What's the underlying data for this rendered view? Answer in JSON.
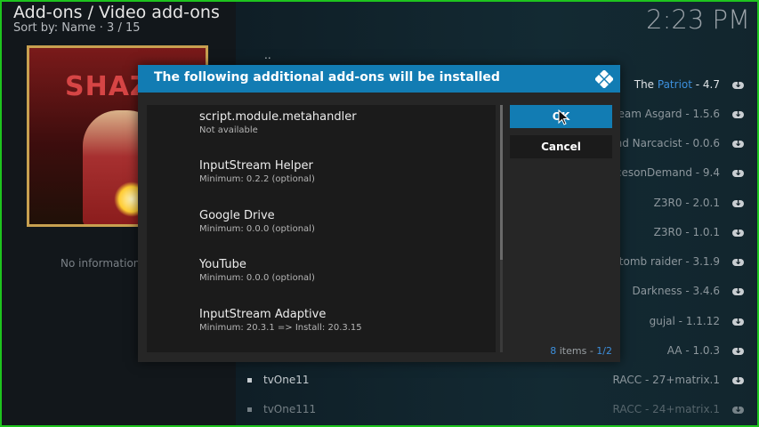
{
  "header": {
    "title": "Add-ons / Video add-ons",
    "sort": "Sort by: Name  ·  3 / 15",
    "clock": "2:23 PM"
  },
  "poster": {
    "text": "SHAZAM"
  },
  "left": {
    "no_info": "No information a"
  },
  "list": {
    "parent": "..",
    "right_items": [
      {
        "prefix": "The ",
        "highlight": "Patriot",
        "suffix": " - 4.7"
      },
      {
        "prefix": "Team Asgard - 1.5.6"
      },
      {
        "prefix": "ot and Narcacist - 0.0.6"
      },
      {
        "prefix": "RacesonDemand - 9.4"
      },
      {
        "prefix": "Z3R0 - 2.0.1"
      },
      {
        "prefix": "Z3R0 - 1.0.1"
      },
      {
        "prefix": "tomb raider - 3.1.9"
      },
      {
        "prefix": "Darkness - 3.4.6"
      },
      {
        "prefix": "gujal - 1.1.12"
      },
      {
        "prefix": "AA - 1.0.3"
      },
      {
        "prefix": "RACC - 27+matrix.1"
      },
      {
        "prefix": "RACC - 24+matrix.1"
      }
    ],
    "rows": [
      {
        "name": "tvOne11"
      },
      {
        "name": "tvOne111"
      }
    ]
  },
  "dialog": {
    "title": "The following additional add-ons will be installed",
    "items": [
      {
        "name": "script.module.metahandler",
        "sub": "Not available"
      },
      {
        "name": "InputStream Helper",
        "sub": "Minimum: 0.2.2 (optional)"
      },
      {
        "name": "Google Drive",
        "sub": "Minimum: 0.0.0 (optional)"
      },
      {
        "name": "YouTube",
        "sub": "Minimum: 0.0.0 (optional)"
      },
      {
        "name": "InputStream Adaptive",
        "sub": "Minimum: 20.3.1 => Install: 20.3.15"
      }
    ],
    "ok_label": "OK",
    "cancel_label": "Cancel",
    "count": {
      "items": "8",
      "items_word": " items - ",
      "page": "1/2"
    }
  },
  "colors": {
    "accent": "#127cb3",
    "frame": "#1ec41e",
    "highlight": "#3c8fdc"
  }
}
